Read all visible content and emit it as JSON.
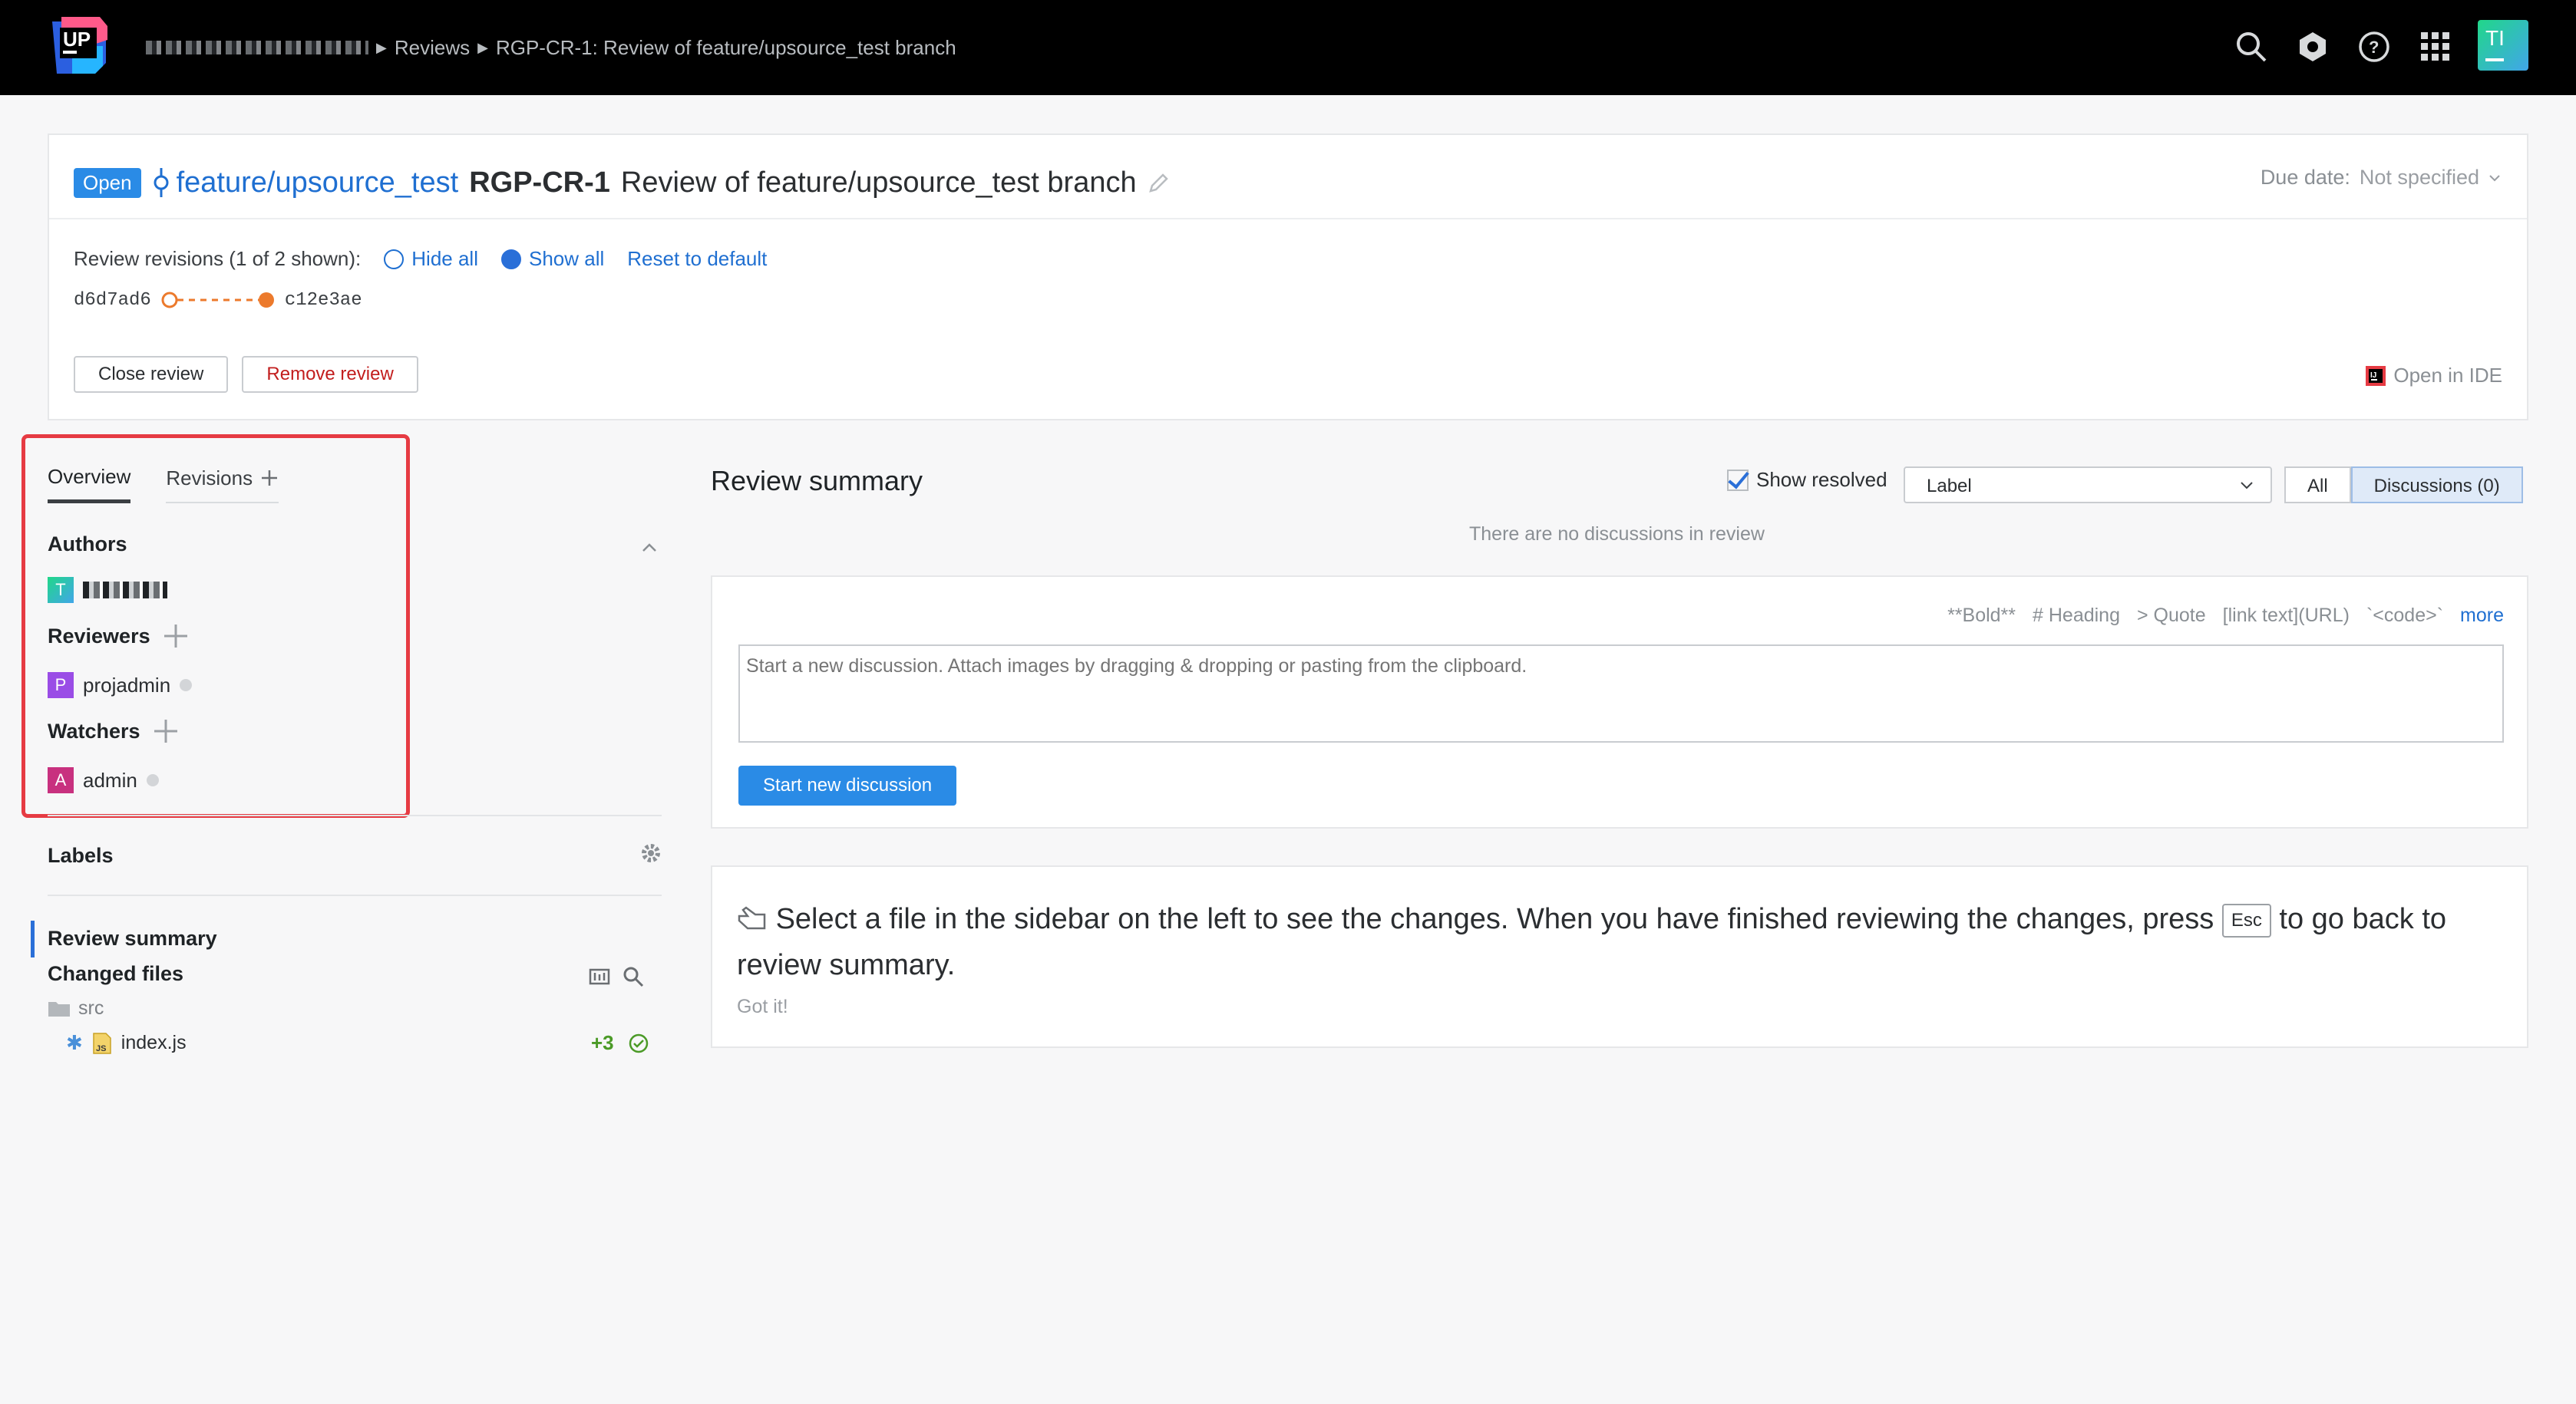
{
  "topbar": {
    "logo_text": "UP",
    "breadcrumb": {
      "reviews_label": "Reviews",
      "current_label": "RGP-CR-1: Review of feature/upsource_test branch"
    },
    "avatar_initials": "TI",
    "icons": [
      "search-icon",
      "hub-icon",
      "help-icon",
      "apps-grid-icon"
    ]
  },
  "header": {
    "status_badge": "Open",
    "branch": "feature/upsource_test",
    "review_id": "RGP-CR-1",
    "review_title": "Review of feature/upsource_test branch",
    "due_label": "Due date:",
    "due_value": "Not specified",
    "revisions_label": "Review revisions (1 of 2 shown):",
    "hide_all": "Hide all",
    "show_all": "Show all",
    "reset_default": "Reset to default",
    "rev_from": "d6d7ad6",
    "rev_to": "c12e3ae",
    "close_review": "Close review",
    "remove_review": "Remove review",
    "open_in_ide": "Open in IDE"
  },
  "sidebar": {
    "tabs": [
      {
        "label": "Overview"
      },
      {
        "label": "Revisions"
      }
    ],
    "authors_title": "Authors",
    "author_initial": "T",
    "reviewers_title": "Reviewers",
    "reviewer": {
      "initial": "P",
      "name": "projadmin"
    },
    "watchers_title": "Watchers",
    "watcher": {
      "initial": "A",
      "name": "admin"
    },
    "labels_title": "Labels",
    "nav_review_summary": "Review summary",
    "changed_files_title": "Changed files",
    "folder": "src",
    "file": {
      "name": "index.js",
      "changes": "+3"
    }
  },
  "main": {
    "title": "Review summary",
    "show_resolved": "Show resolved",
    "label_select": "Label",
    "filter_all": "All",
    "filter_discussions": "Discussions (0)",
    "no_discussions": "There are no discussions in review",
    "format_hints": [
      "**Bold**",
      "# Heading",
      "> Quote",
      "[link text](URL)",
      "`<code>`"
    ],
    "format_more": "more",
    "textarea_placeholder": "Start a new discussion. Attach images by dragging & dropping or pasting from the clipboard.",
    "start_discussion": "Start new discussion",
    "info_part1": "Select a file in the sidebar on the left to see the changes. When you have finished reviewing the changes, press",
    "info_key": "Esc",
    "info_part2": "to go back to review summary.",
    "got_it": "Got it!"
  },
  "colors": {
    "accent": "#2a8be6",
    "link": "#1f6fd1",
    "danger": "#c21d1d",
    "highlight": "#e63b43",
    "added": "#4b9a27"
  }
}
